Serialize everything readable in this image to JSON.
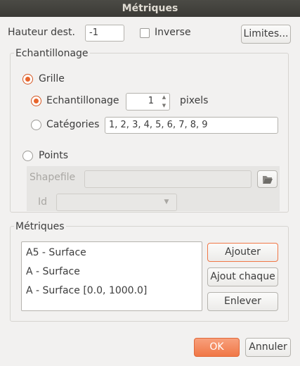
{
  "window": {
    "title": "Métriques"
  },
  "top": {
    "height_label": "Hauteur dest.",
    "height_value": "-1",
    "inverse_label": "Inverse",
    "limits_button": "Limites..."
  },
  "sampling": {
    "group_title": "Echantillonage",
    "grid_label": "Grille",
    "sampling_label": "Echantillonage",
    "sampling_value": "1",
    "pixels_label": "pixels",
    "categories_label": "Catégories",
    "categories_value": "1, 2, 3, 4, 5, 6, 7, 8, 9",
    "points_label": "Points",
    "shapefile_label": "Shapefile",
    "id_label": "Id"
  },
  "metrics": {
    "group_title": "Métriques",
    "items": [
      {
        "label": "A5 - Surface"
      },
      {
        "label": "A - Surface"
      },
      {
        "label": "A - Surface [0.0, 1000.0]"
      }
    ],
    "add_button": "Ajouter",
    "add_each_button": "Ajout chaque",
    "remove_button": "Enlever"
  },
  "footer": {
    "ok_button": "OK",
    "cancel_button": "Annuler"
  },
  "colors": {
    "accent": "#f07746",
    "titlebar": "#3f3e3a"
  }
}
